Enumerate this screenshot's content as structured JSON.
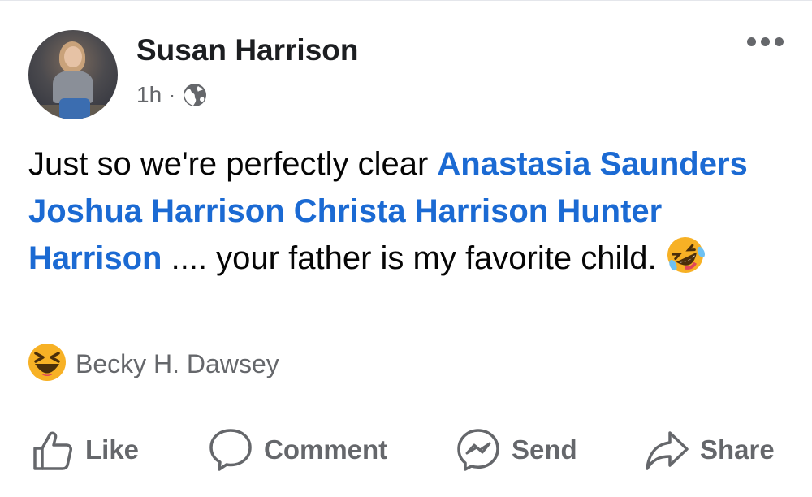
{
  "post": {
    "author": "Susan Harrison",
    "time": "1h",
    "separator": "·",
    "privacy_icon": "globe-icon",
    "menu_icon": "more-dots-icon",
    "text": {
      "intro": "Just so we're perfectly clear ",
      "mentions": [
        "Anastasia Saunders",
        "Joshua Harrison",
        "Christa Harrison",
        "Hunter Harrison"
      ],
      "after": " .... your father is my favorite child.",
      "emoji": "rolling-on-floor-laughing-emoji"
    },
    "reaction": {
      "icon": "haha-reaction-icon",
      "reactor": "Becky H. Dawsey"
    }
  },
  "actions": {
    "like": "Like",
    "comment": "Comment",
    "send": "Send",
    "share": "Share"
  },
  "colors": {
    "mention": "#1b6ad3",
    "secondary_text": "#65676b",
    "primary_text": "#050505",
    "reaction_yellow": "#f7b125"
  }
}
